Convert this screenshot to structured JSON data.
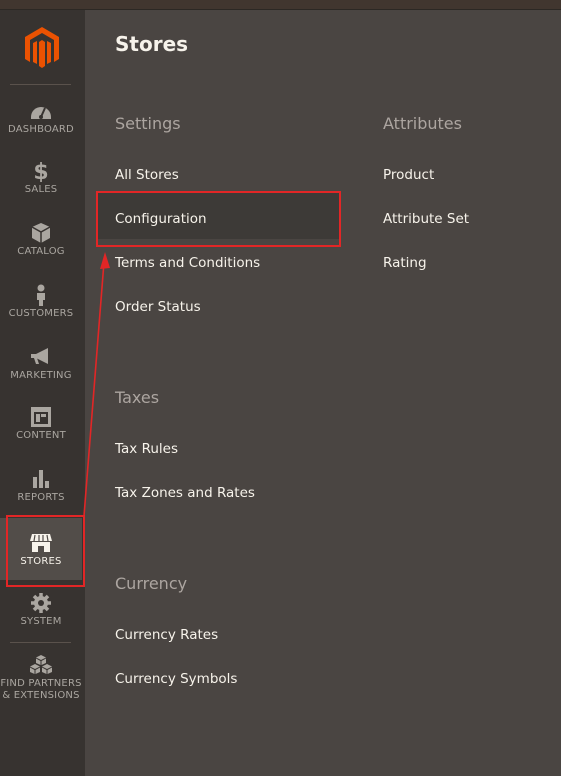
{
  "sidebar": {
    "items": [
      {
        "label": "DASHBOARD",
        "icon": "dashboard-icon"
      },
      {
        "label": "SALES",
        "icon": "dollar-icon"
      },
      {
        "label": "CATALOG",
        "icon": "box-icon"
      },
      {
        "label": "CUSTOMERS",
        "icon": "person-icon"
      },
      {
        "label": "MARKETING",
        "icon": "megaphone-icon"
      },
      {
        "label": "CONTENT",
        "icon": "layout-icon"
      },
      {
        "label": "REPORTS",
        "icon": "bar-chart-icon"
      },
      {
        "label": "STORES",
        "icon": "storefront-icon"
      },
      {
        "label": "SYSTEM",
        "icon": "gear-icon"
      },
      {
        "label": "FIND PARTNERS",
        "label2": "& EXTENSIONS",
        "icon": "cubes-icon"
      }
    ],
    "active": "STORES"
  },
  "panel": {
    "title": "Stores",
    "settings": {
      "title": "Settings",
      "links": [
        "All Stores",
        "Configuration",
        "Terms and Conditions",
        "Order Status"
      ]
    },
    "taxes": {
      "title": "Taxes",
      "links": [
        "Tax Rules",
        "Tax Zones and Rates"
      ]
    },
    "currency": {
      "title": "Currency",
      "links": [
        "Currency Rates",
        "Currency Symbols"
      ]
    },
    "attributes": {
      "title": "Attributes",
      "links": [
        "Product",
        "Attribute Set",
        "Rating"
      ]
    }
  },
  "colors": {
    "sidebar_bg": "#373330",
    "panel_bg": "#4a4542",
    "brand_orange": "#eb5202",
    "annotation_red": "#e22626"
  }
}
